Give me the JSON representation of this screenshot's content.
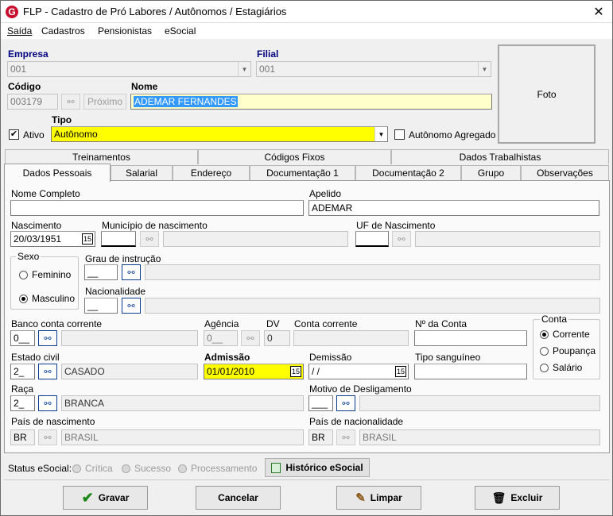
{
  "window": {
    "title": "FLP - Cadastro de Pró Labores / Autônomos / Estagiários",
    "close": "✕"
  },
  "menu": [
    "Saída",
    "Cadastros",
    "Pensionistas",
    "eSocial"
  ],
  "header": {
    "empresa_label": "Empresa",
    "empresa_value": "001",
    "filial_label": "Filial",
    "filial_value": "001",
    "codigo_label": "Código",
    "codigo_value": "003179",
    "proximo_label": "Próximo",
    "nome_label": "Nome",
    "nome_value": "ADEMAR FERNANDES",
    "ativo_label": "Ativo",
    "tipo_label": "Tipo",
    "tipo_value": "Autônomo",
    "agregado_label": "Autônomo Agregado",
    "foto_label": "Foto"
  },
  "tabs_top": [
    "Treinamentos",
    "Códigos Fixos",
    "Dados Trabalhistas"
  ],
  "tabs_bottom": [
    "Dados Pessoais",
    "Salarial",
    "Endereço",
    "Documentação 1",
    "Documentação 2",
    "Grupo",
    "Observações"
  ],
  "form": {
    "nome_completo_label": "Nome Completo",
    "nome_completo_value": "",
    "apelido_label": "Apelido",
    "apelido_value": "ADEMAR",
    "nascimento_label": "Nascimento",
    "nascimento_value": "20/03/1951",
    "municipio_label": "Município de nascimento",
    "municipio_code": "",
    "uf_label": "UF de Nascimento",
    "sexo_label": "Sexo",
    "feminino": "Feminino",
    "masculino": "Masculino",
    "grau_label": "Grau de instrução",
    "grau_code": "__",
    "nacionalidade_label": "Nacionalidade",
    "nacionalidade_code": "__",
    "banco_label": "Banco conta corrente",
    "banco_code": "0__",
    "agencia_label": "Agência",
    "agencia_value": "0__",
    "dv_label": "DV",
    "dv_value": "0",
    "conta_corrente_label": "Conta corrente",
    "num_conta_label": "Nº da Conta",
    "conta_group_label": "Conta",
    "conta_options": [
      "Corrente",
      "Poupança",
      "Salário"
    ],
    "estado_civil_label": "Estado civil",
    "estado_civil_code": "2_",
    "estado_civil_value": "CASADO",
    "admissao_label": "Admissão",
    "admissao_value": "01/01/2010",
    "demissao_label": "Demissão",
    "demissao_value": " / /",
    "tipo_sanguineo_label": "Tipo sanguíneo",
    "raca_label": "Raça",
    "raca_code": "2_",
    "raca_value": "BRANCA",
    "motivo_label": "Motivo de Desligamento",
    "motivo_code": "___",
    "pais_nasc_label": "País de nascimento",
    "pais_nasc_code": "BR",
    "pais_nasc_value": "BRASIL",
    "pais_nac_label": "País de nacionalidade",
    "pais_nac_code": "BR",
    "pais_nac_value": "BRASIL"
  },
  "status": {
    "label": "Status eSocial:",
    "items": [
      "Crítica",
      "Sucesso",
      "Processamento"
    ],
    "historico": "Histórico eSocial"
  },
  "buttons": {
    "gravar": "Gravar",
    "cancelar": "Cancelar",
    "limpar": "Limpar",
    "excluir": "Excluir"
  },
  "colors": {
    "brand": "#c8102e",
    "highlight": "#ffff00",
    "selection": "#3399ff",
    "label_blue": "#00007f"
  }
}
